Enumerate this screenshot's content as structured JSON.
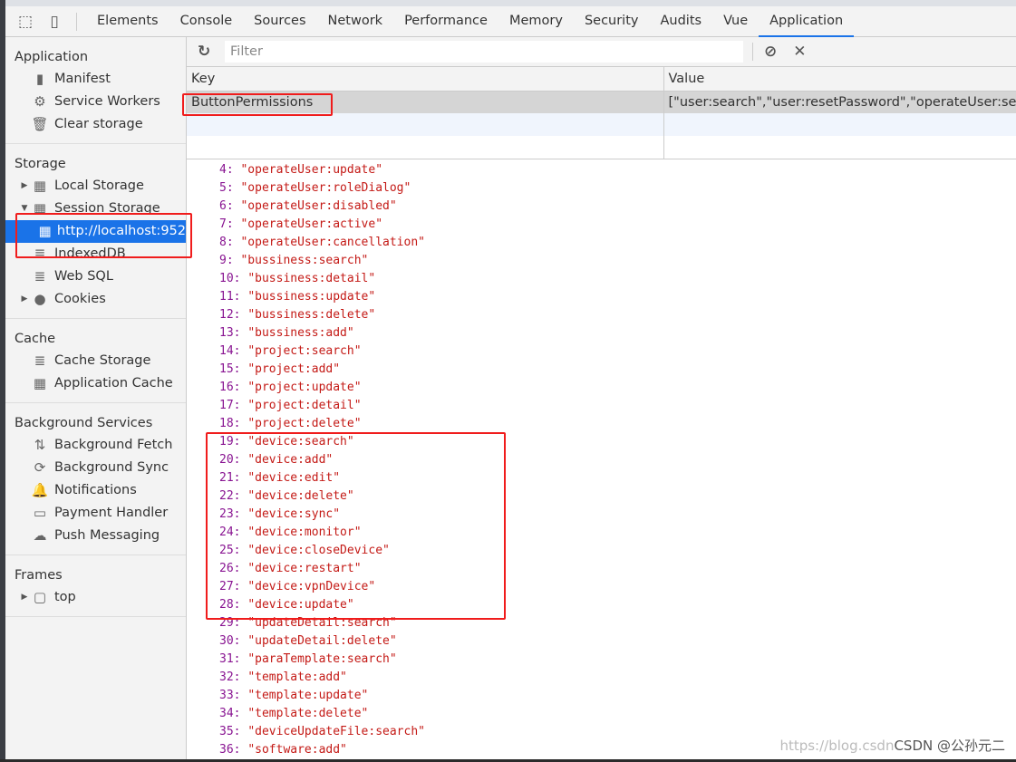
{
  "tabs": [
    "Elements",
    "Console",
    "Sources",
    "Network",
    "Performance",
    "Memory",
    "Security",
    "Audits",
    "Vue",
    "Application"
  ],
  "active_tab": "Application",
  "sidebar": {
    "sections": [
      {
        "title": "Application",
        "items": [
          {
            "label": "Manifest",
            "icon": "file-icon"
          },
          {
            "label": "Service Workers",
            "icon": "gear-icon"
          },
          {
            "label": "Clear storage",
            "icon": "trash-icon"
          }
        ]
      },
      {
        "title": "Storage",
        "items": [
          {
            "label": "Local Storage",
            "icon": "grid-icon"
          },
          {
            "label": "Session Storage",
            "icon": "grid-icon"
          },
          {
            "label": "http://localhost:952",
            "icon": "grid-icon"
          },
          {
            "label": "IndexedDB",
            "icon": "database-icon"
          },
          {
            "label": "Web SQL",
            "icon": "database-icon"
          },
          {
            "label": "Cookies",
            "icon": "cookie-icon"
          }
        ]
      },
      {
        "title": "Cache",
        "items": [
          {
            "label": "Cache Storage",
            "icon": "database-icon"
          },
          {
            "label": "Application Cache",
            "icon": "grid-icon"
          }
        ]
      },
      {
        "title": "Background Services",
        "items": [
          {
            "label": "Background Fetch",
            "icon": "arrows-icon"
          },
          {
            "label": "Background Sync",
            "icon": "sync-icon"
          },
          {
            "label": "Notifications",
            "icon": "bell-icon"
          },
          {
            "label": "Payment Handler",
            "icon": "card-icon"
          },
          {
            "label": "Push Messaging",
            "icon": "cloud-icon"
          }
        ]
      },
      {
        "title": "Frames",
        "items": [
          {
            "label": "top",
            "icon": "frame-icon"
          }
        ]
      }
    ]
  },
  "toolbar": {
    "filter_placeholder": "Filter"
  },
  "table": {
    "headers": [
      "Key",
      "Value"
    ],
    "rows": [
      {
        "key": "ButtonPermissions",
        "value": "[\"user:search\",\"user:resetPassword\",\"operateUser:search\",\"o"
      }
    ]
  },
  "preview": [
    [
      "4",
      "\"operateUser:update\""
    ],
    [
      "5",
      "\"operateUser:roleDialog\""
    ],
    [
      "6",
      "\"operateUser:disabled\""
    ],
    [
      "7",
      "\"operateUser:active\""
    ],
    [
      "8",
      "\"operateUser:cancellation\""
    ],
    [
      "9",
      "\"bussiness:search\""
    ],
    [
      "10",
      "\"bussiness:detail\""
    ],
    [
      "11",
      "\"bussiness:update\""
    ],
    [
      "12",
      "\"bussiness:delete\""
    ],
    [
      "13",
      "\"bussiness:add\""
    ],
    [
      "14",
      "\"project:search\""
    ],
    [
      "15",
      "\"project:add\""
    ],
    [
      "16",
      "\"project:update\""
    ],
    [
      "17",
      "\"project:detail\""
    ],
    [
      "18",
      "\"project:delete\""
    ],
    [
      "19",
      "\"device:search\""
    ],
    [
      "20",
      "\"device:add\""
    ],
    [
      "21",
      "\"device:edit\""
    ],
    [
      "22",
      "\"device:delete\""
    ],
    [
      "23",
      "\"device:sync\""
    ],
    [
      "24",
      "\"device:monitor\""
    ],
    [
      "25",
      "\"device:closeDevice\""
    ],
    [
      "26",
      "\"device:restart\""
    ],
    [
      "27",
      "\"device:vpnDevice\""
    ],
    [
      "28",
      "\"device:update\""
    ],
    [
      "29",
      "\"updateDetail:search\""
    ],
    [
      "30",
      "\"updateDetail:delete\""
    ],
    [
      "31",
      "\"paraTemplate:search\""
    ],
    [
      "32",
      "\"template:add\""
    ],
    [
      "33",
      "\"template:update\""
    ],
    [
      "34",
      "\"template:delete\""
    ],
    [
      "35",
      "\"deviceUpdateFile:search\""
    ],
    [
      "36",
      "\"software:add\""
    ]
  ],
  "watermark": {
    "url": "https://blog.csdn",
    "brand": "CSDN @公孙元二"
  },
  "colors": {
    "accent": "#1a73e8",
    "highlight": "#f01c1c",
    "index": "#881391",
    "string": "#c41a16"
  }
}
